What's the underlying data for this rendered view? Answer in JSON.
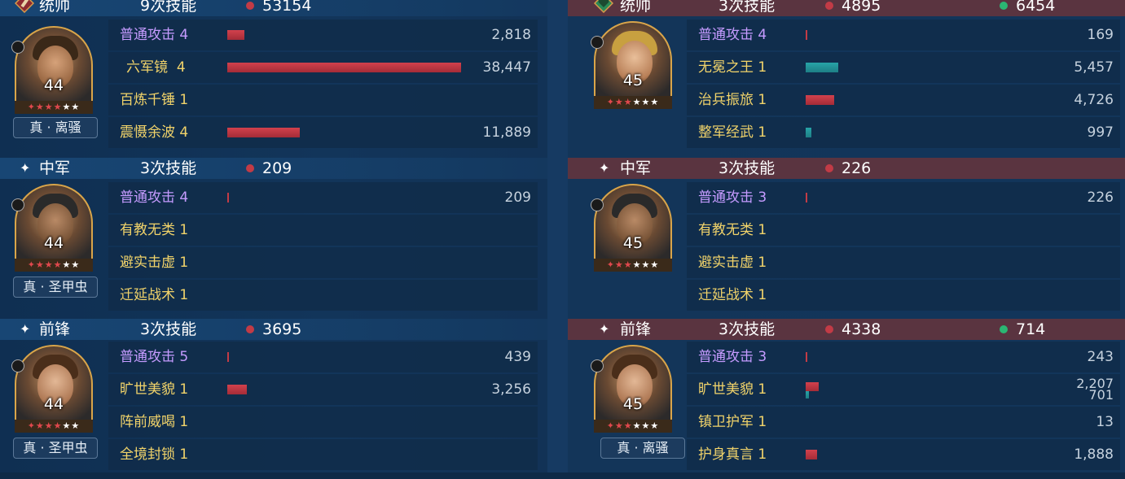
{
  "left": {
    "sections": [
      {
        "role": "统帅",
        "count": "9次技能",
        "damage": "53154",
        "level": "44",
        "stars_on": 3,
        "stars_total": 6,
        "tag": "真 · 离骚",
        "skills": [
          {
            "name": "普通攻击",
            "lv": "4",
            "value": "2,818"
          },
          {
            "name": "六军镜",
            "lv": "4",
            "value": "38,447"
          },
          {
            "name": "百炼千锤",
            "lv": "1",
            "value": ""
          },
          {
            "name": "震慑余波",
            "lv": "4",
            "value": "11,889"
          }
        ]
      },
      {
        "role": "中军",
        "count": "3次技能",
        "damage": "209",
        "level": "44",
        "stars_on": 3,
        "stars_total": 6,
        "tag": "真 · 圣甲虫",
        "skills": [
          {
            "name": "普通攻击",
            "lv": "4",
            "value": "209"
          },
          {
            "name": "有教无类",
            "lv": "1",
            "value": ""
          },
          {
            "name": "避实击虚",
            "lv": "1",
            "value": ""
          },
          {
            "name": "迁延战术",
            "lv": "1",
            "value": ""
          }
        ]
      },
      {
        "role": "前锋",
        "count": "3次技能",
        "damage": "3695",
        "level": "44",
        "stars_on": 3,
        "stars_total": 6,
        "tag": "真 · 圣甲虫",
        "skills": [
          {
            "name": "普通攻击",
            "lv": "5",
            "value": "439"
          },
          {
            "name": "旷世美貌",
            "lv": "1",
            "value": "3,256"
          },
          {
            "name": "阵前威喝",
            "lv": "1",
            "value": ""
          },
          {
            "name": "全境封锁",
            "lv": "1",
            "value": ""
          }
        ]
      }
    ]
  },
  "right": {
    "sections": [
      {
        "role": "统帅",
        "count": "3次技能",
        "damage": "4895",
        "heal": "6454",
        "level": "45",
        "stars_on": 2,
        "stars_total": 6,
        "tag": "",
        "skills": [
          {
            "name": "普通攻击",
            "lv": "4",
            "value": "169"
          },
          {
            "name": "无冕之王",
            "lv": "1",
            "value": "5,457"
          },
          {
            "name": "治兵振旅",
            "lv": "1",
            "value": "4,726"
          },
          {
            "name": "整军经武",
            "lv": "1",
            "value": "997"
          }
        ]
      },
      {
        "role": "中军",
        "count": "3次技能",
        "damage": "226",
        "heal": "",
        "level": "45",
        "stars_on": 2,
        "stars_total": 6,
        "tag": "",
        "skills": [
          {
            "name": "普通攻击",
            "lv": "3",
            "value": "226"
          },
          {
            "name": "有教无类",
            "lv": "1",
            "value": ""
          },
          {
            "name": "避实击虚",
            "lv": "1",
            "value": ""
          },
          {
            "name": "迁延战术",
            "lv": "1",
            "value": ""
          }
        ]
      },
      {
        "role": "前锋",
        "count": "3次技能",
        "damage": "4338",
        "heal": "714",
        "level": "45",
        "stars_on": 2,
        "stars_total": 6,
        "tag": "真 · 离骚",
        "skills": [
          {
            "name": "普通攻击",
            "lv": "3",
            "value": "243"
          },
          {
            "name": "旷世美貌",
            "lv": "1",
            "value": "2,207",
            "value2": "701"
          },
          {
            "name": "镇卫护军",
            "lv": "1",
            "value": "13"
          },
          {
            "name": "护身真言",
            "lv": "1",
            "value": "1,888"
          }
        ]
      }
    ]
  },
  "colors": {
    "damage_dot": "#c23b46",
    "heal_dot": "#2bb673",
    "attack_purple": "#c59bff",
    "skill_yellow": "#f1d36a",
    "bar_red": "#c23b46",
    "bar_teal": "#27a3a7"
  }
}
